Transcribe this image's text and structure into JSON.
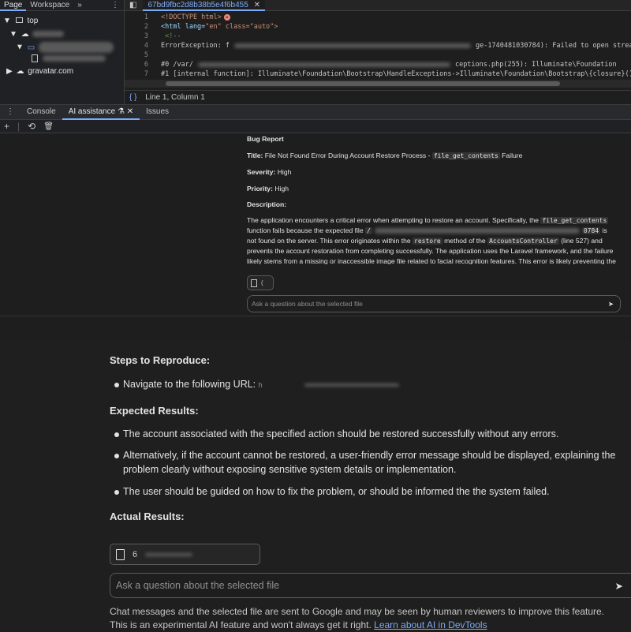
{
  "nav": {
    "tabs": [
      "Page",
      "Workspace"
    ],
    "more": "»",
    "tree": {
      "top": "top",
      "gravatar": "gravatar.com"
    }
  },
  "editor": {
    "tab_name": "67bd9fbc2d8b38b5e4f6b455",
    "lines": [
      {
        "n": "1",
        "a": "<!DOCTYPE html>",
        "b": ""
      },
      {
        "n": "2",
        "a": "<html lang=",
        "b": "\"en\" class=\"auto\">"
      },
      {
        "n": "3",
        "a": "    <!--",
        "b": ""
      },
      {
        "n": "4",
        "a": "ErrorException: f",
        "b": "ge-1740481030784): Failed to open strea"
      },
      {
        "n": "5",
        "a": "",
        "b": ""
      },
      {
        "n": "6",
        "a": "#0 /var/",
        "b": "ceptions.php(255): Illuminate\\Foundation"
      },
      {
        "n": "7",
        "a": "#1 [internal function]: Illuminate\\Foundation\\Bootstrap\\HandleExceptions->Illuminate\\Foundation\\Bootstrap\\{closure}()",
        "b": ""
      }
    ],
    "status": "Line 1, Column 1"
  },
  "drawer": {
    "tabs": [
      "Console",
      "AI assistance",
      "Issues"
    ],
    "tools": [
      "+",
      "⟲",
      "🗑"
    ]
  },
  "report": {
    "heading": "Bug Report",
    "title_label": "Title:",
    "title_text": "File Not Found Error During Account Restore Process -",
    "title_code": "file_get_contents",
    "title_tail": "Failure",
    "severity_label": "Severity:",
    "severity": "High",
    "priority_label": "Priority:",
    "priority": "High",
    "desc_label": "Description:",
    "desc_1": "The application encounters a critical error when attempting to restore an account. Specifically, the",
    "desc_code1": "file_get_contents",
    "desc_2": "function fails because the expected file",
    "desc_code2": "/",
    "desc_code3": "0784",
    "desc_3": "is",
    "desc_4": "not found on the server. This error originates within the",
    "desc_code4": "restore",
    "desc_5": "method of the",
    "desc_code5": "AccountsController",
    "desc_6": "(line 527) and",
    "desc_7": "prevents the account restoration from completing successfully. The application uses the Laravel framework, and the failure",
    "desc_8": "likely stems from a missing or inaccessible image file related to facial recognition features. This error is likely preventing the",
    "ask_placeholder": "Ask a question about the selected file"
  },
  "lower": {
    "steps_heading": "Steps to Reproduce:",
    "step1": "Navigate to the following URL:",
    "step1_tail": "h",
    "expected_heading": "Expected Results:",
    "expected": [
      "The account associated with the specified action should be restored successfully without any errors.",
      "Alternatively, if the account cannot be restored, a user-friendly error message should be displayed, explaining the problem clearly without exposing sensitive system details or implementation.",
      "The user should be guided on how to fix the problem, or should be informed the the system failed."
    ],
    "actual_heading": "Actual Results:",
    "file_chip": "6",
    "ask_placeholder": "Ask a question about the selected file",
    "disclaimer": "Chat messages and the selected file are sent to Google and may be seen by human reviewers to improve this feature. This is an experimental AI feature and won't always get it right.",
    "learn_link": "Learn about AI in DevTools"
  }
}
